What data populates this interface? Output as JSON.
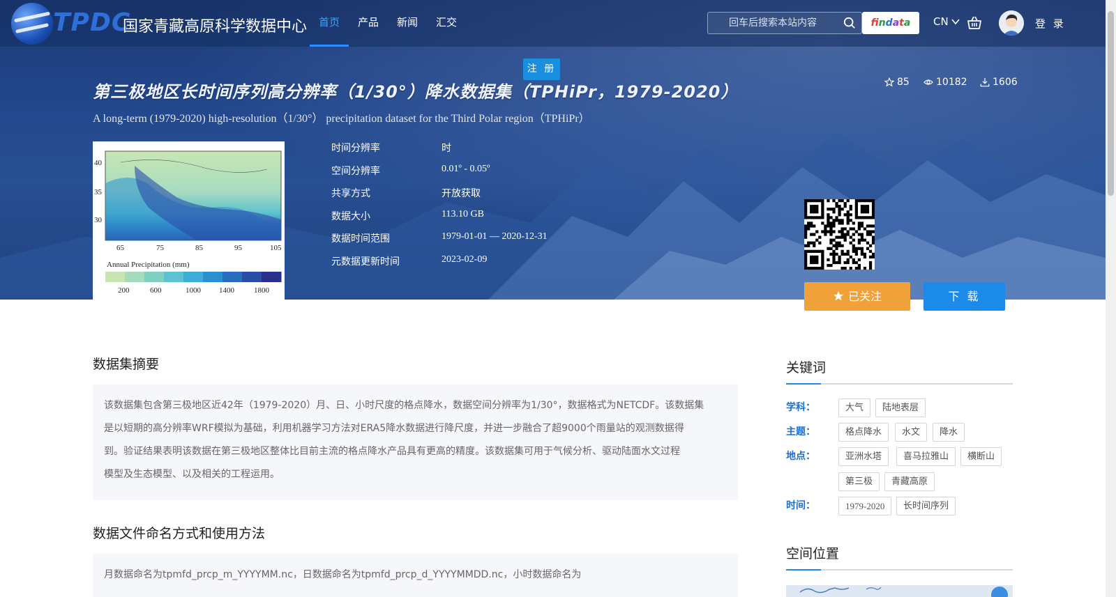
{
  "header": {
    "logo_text": "TPDC",
    "site_name": "国家青藏高原科学数据中心",
    "nav": [
      {
        "label": "首页",
        "active": true
      },
      {
        "label": "产品",
        "active": false
      },
      {
        "label": "新闻",
        "active": false
      },
      {
        "label": "汇交",
        "active": false
      }
    ],
    "search_placeholder": "回车后搜索本站内容",
    "findata_label": "findata",
    "lang_label": "CN",
    "login_label": "登 录",
    "register_label": "注 册"
  },
  "dataset": {
    "title_cn": "第三极地区长时间序列高分辨率（1/30°）降水数据集（TPHiPr，1979-2020）",
    "title_en": "A long-term (1979-2020) high-resolution（1/30°） precipitation dataset for the Third Polar region（TPHiPr）",
    "stars": "85",
    "views": "10182",
    "downloads": "1606",
    "meta": [
      {
        "label": "时间分辨率",
        "value": "时"
      },
      {
        "label": "空间分辨率",
        "value": "0.01º - 0.05º"
      },
      {
        "label": "共享方式",
        "value": "开放获取"
      },
      {
        "label": "数据大小",
        "value": "113.10 GB"
      },
      {
        "label": "数据时间范围",
        "value": "1979-01-01 — 2020-12-31"
      },
      {
        "label": "元数据更新时间",
        "value": "2023-02-09"
      }
    ],
    "thumbnail": {
      "y_ticks": [
        "40",
        "35",
        "30"
      ],
      "x_ticks": [
        "65",
        "75",
        "85",
        "95",
        "105"
      ],
      "legend_title": "Annual Precipitation (mm)",
      "legend_ticks": [
        "200",
        "600",
        "1000",
        "1400",
        "1800"
      ],
      "colors": [
        "#c8e6b4",
        "#a6dcbb",
        "#7fd0c2",
        "#5bc2cf",
        "#3aaed8",
        "#2a8fcf",
        "#2a6cbf",
        "#2a4ca8",
        "#2b2f8c"
      ]
    },
    "follow_label": "已关注",
    "download_label": "下 载"
  },
  "content": {
    "abstract_title": "数据集摘要",
    "abstract_lines": [
      "该数据集包含第三极地区近42年（1979-2020）月、日、小时尺度的格点降水，数据空间分辨率为1/30°，数据格式为NETCDF。该数据集",
      "是以短期的高分辨率WRF模拟为基础，利用机器学习方法对ERA5降水数据进行降尺度，并进一步融合了超9000个雨量站的观测数据得",
      "到。验证结果表明该数据在第三极地区整体比目前主流的格点降水产品具有更高的精度。该数据集可用于气候分析、驱动陆面水文过程",
      "模型及生态模型、以及相关的工程运用。"
    ],
    "naming_title": "数据文件命名方式和使用方法",
    "naming_lines": [
      "月数据命名为tpmfd_prcp_m_YYYYMM.nc，日数据命名为tpmfd_prcp_d_YYYYMMDD.nc，小时数据命名为"
    ]
  },
  "sidebar": {
    "keywords_title": "关键词",
    "groups": [
      {
        "label": "学科：",
        "tags": [
          "大气",
          "陆地表层"
        ]
      },
      {
        "label": "主题：",
        "tags": [
          "格点降水",
          "水文",
          "降水"
        ]
      },
      {
        "label": "地点：",
        "tags": [
          "亚洲水塔",
          "喜马拉雅山",
          "横断山",
          "第三极",
          "青藏高原"
        ]
      },
      {
        "label": "时间：",
        "tags": [
          "1979-2020",
          "长时间序列"
        ]
      }
    ],
    "location_title": "空间位置"
  }
}
